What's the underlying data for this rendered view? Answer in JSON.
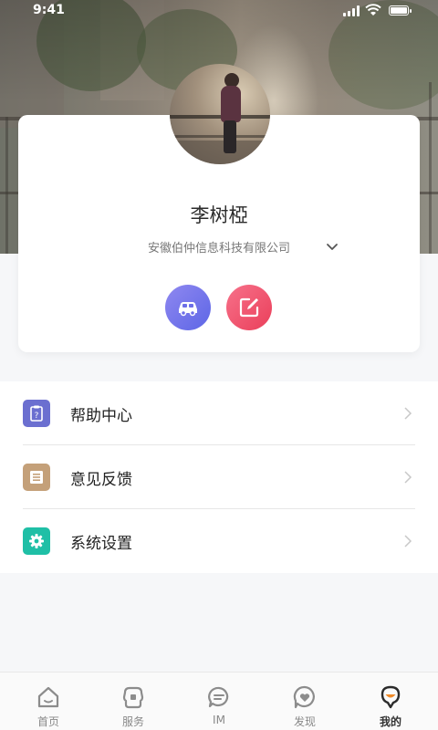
{
  "status_bar": {
    "time": "9:41"
  },
  "profile": {
    "name": "李树椏",
    "company": "安徽伯仲信息科技有限公司"
  },
  "actions": [
    {
      "icon": "car-icon",
      "color_from": "#8f88f0",
      "color_to": "#5d66e6"
    },
    {
      "icon": "edit-icon",
      "color_from": "#f7718a",
      "color_to": "#ea3f5a"
    }
  ],
  "menu": {
    "items": [
      {
        "label": "帮助中心",
        "icon": "help-center-icon",
        "color": "#6b6fd0"
      },
      {
        "label": "意见反馈",
        "icon": "feedback-icon",
        "color": "#c4a079"
      },
      {
        "label": "系统设置",
        "icon": "settings-gear-icon",
        "color": "#1fbfa6"
      }
    ]
  },
  "tabbar": {
    "tabs": [
      {
        "label": "首页",
        "icon": "home-icon"
      },
      {
        "label": "服务",
        "icon": "service-icon"
      },
      {
        "label": "IM",
        "icon": "chat-icon"
      },
      {
        "label": "发现",
        "icon": "discover-heart-icon"
      },
      {
        "label": "我的",
        "icon": "profile-icon",
        "active": true
      }
    ],
    "active_color": "#f08a28"
  }
}
